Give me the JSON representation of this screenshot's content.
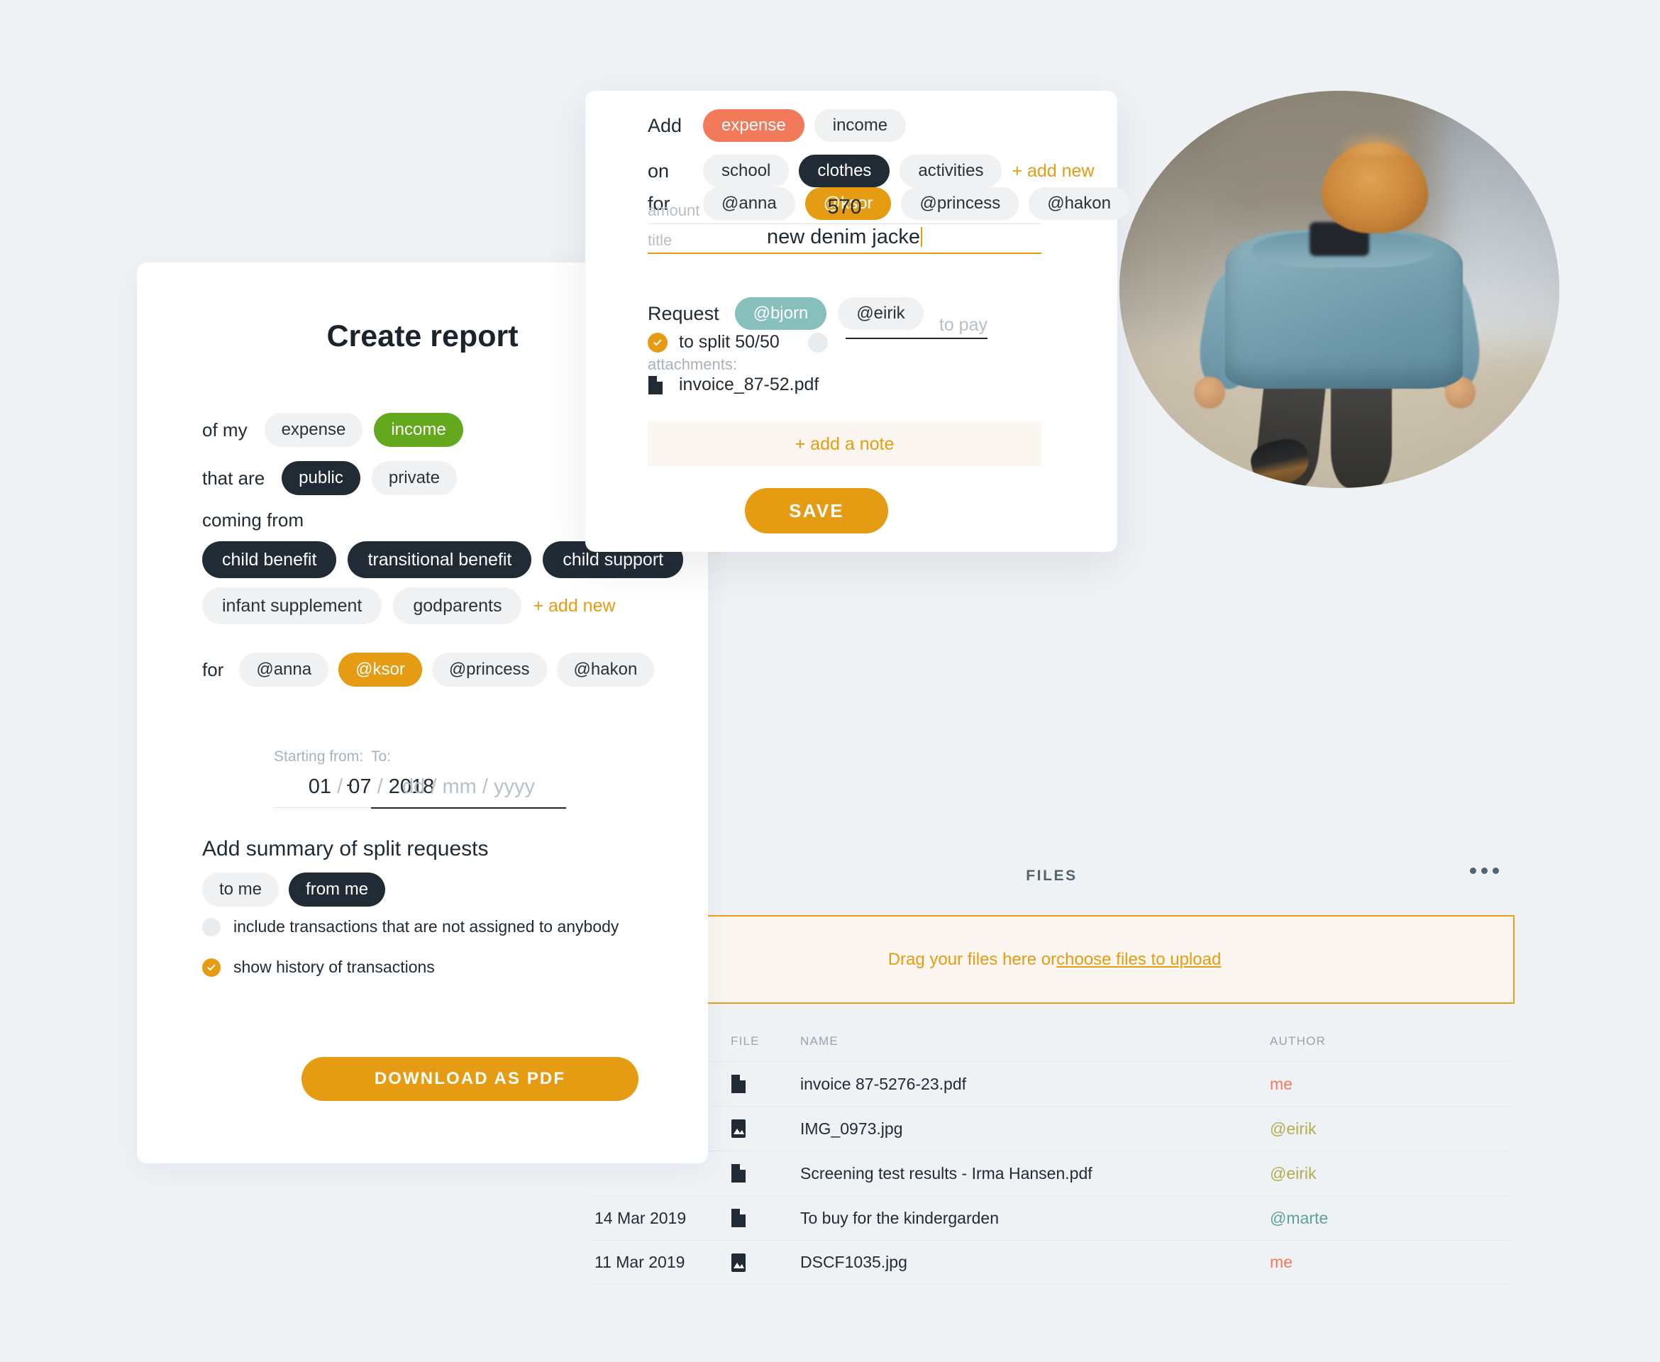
{
  "report_card": {
    "title": "Create report",
    "type_row": {
      "label": "of my",
      "options": [
        {
          "label": "expense",
          "selected": false,
          "style": "plain"
        },
        {
          "label": "income",
          "selected": true,
          "style": "green"
        }
      ]
    },
    "visibility_row": {
      "label": "that are",
      "options": [
        {
          "label": "public",
          "selected": true,
          "style": "dark"
        },
        {
          "label": "private",
          "selected": false,
          "style": "plain"
        }
      ]
    },
    "source_row": {
      "label": "coming from",
      "options": [
        {
          "label": "child benefit",
          "selected": true,
          "style": "dark"
        },
        {
          "label": "transitional benefit",
          "selected": true,
          "style": "dark"
        },
        {
          "label": "child support",
          "selected": true,
          "style": "dark"
        },
        {
          "label": "infant supplement",
          "selected": false,
          "style": "plain"
        },
        {
          "label": "godparents",
          "selected": false,
          "style": "plain"
        }
      ],
      "add_new": "+ add new"
    },
    "for_row": {
      "label": "for",
      "options": [
        {
          "label": "@anna",
          "selected": false,
          "style": "plain"
        },
        {
          "label": "@ksor",
          "selected": true,
          "style": "amber"
        },
        {
          "label": "@princess",
          "selected": false,
          "style": "plain"
        },
        {
          "label": "@hakon",
          "selected": false,
          "style": "plain"
        }
      ]
    },
    "date_from": {
      "label": "Starting from:",
      "day": "01",
      "month": "07",
      "year": "2018",
      "sep": "/"
    },
    "date_to": {
      "label": "To:",
      "placeholder": "dd / mm / yyyy"
    },
    "dash": "-",
    "summary_label": "Add summary of split requests",
    "summary_options": [
      {
        "label": "to me",
        "selected": false,
        "style": "plain"
      },
      {
        "label": "from me",
        "selected": true,
        "style": "dark"
      }
    ],
    "checkboxes": [
      {
        "label": "include transactions that are not assigned to anybody",
        "checked": false
      },
      {
        "label": "show history of transactions",
        "checked": true
      }
    ],
    "download_label": "DOWNLOAD AS PDF"
  },
  "add_card": {
    "add_row": {
      "label": "Add",
      "options": [
        {
          "label": "expense",
          "selected": true,
          "style": "coral"
        },
        {
          "label": "income",
          "selected": false,
          "style": "plain"
        }
      ]
    },
    "on_row": {
      "label": "on",
      "options": [
        {
          "label": "school",
          "selected": false,
          "style": "plain"
        },
        {
          "label": "clothes",
          "selected": true,
          "style": "dark"
        },
        {
          "label": "activities",
          "selected": false,
          "style": "plain"
        }
      ],
      "add_new": "+ add new"
    },
    "for_row": {
      "label": "for",
      "options": [
        {
          "label": "@anna",
          "selected": false,
          "style": "plain"
        },
        {
          "label": "@ksor",
          "selected": true,
          "style": "amber"
        },
        {
          "label": "@princess",
          "selected": false,
          "style": "plain"
        },
        {
          "label": "@hakon",
          "selected": false,
          "style": "plain"
        }
      ]
    },
    "amount_field": {
      "label": "amount",
      "value": "570"
    },
    "title_field": {
      "label": "title",
      "value": "new denim jacke"
    },
    "request_row": {
      "label": "Request",
      "options": [
        {
          "label": "@bjorn",
          "selected": true,
          "style": "teal"
        },
        {
          "label": "@eirik",
          "selected": false,
          "style": "plain"
        }
      ]
    },
    "split_option": {
      "label": "to split 50/50",
      "checked": true
    },
    "pay_option": {
      "checked": false,
      "placeholder": "to pay"
    },
    "attachments_label": "attachments:",
    "attachments": [
      {
        "name": "invoice_87-52.pdf",
        "icon": "document-icon"
      }
    ],
    "add_note_label": "+ add a note",
    "save_label": "SAVE"
  },
  "files_panel": {
    "title": "FILES",
    "more_label": "...",
    "dropzone": {
      "text": "Drag your files here or ",
      "link": "choose files to upload"
    },
    "columns": [
      "",
      "FILE",
      "NAME",
      "AUTHOR"
    ],
    "rows": [
      {
        "date": "",
        "icon": "document-icon",
        "name": "invoice 87-5276-23.pdf",
        "author": "me",
        "author_style": "me"
      },
      {
        "date": "",
        "icon": "image-icon",
        "name": "IMG_0973.jpg",
        "author": "@eirik",
        "author_style": "eirik"
      },
      {
        "date": "",
        "icon": "document-icon",
        "name": "Screening test results - Irma Hansen.pdf",
        "author": "@eirik",
        "author_style": "eirik"
      },
      {
        "date": "14 Mar 2019",
        "icon": "document-icon",
        "name": "To buy for the kindergarden",
        "author": "@marte",
        "author_style": "marte"
      },
      {
        "date": "11 Mar 2019",
        "icon": "image-icon",
        "name": "DSCF1035.jpg",
        "author": "me",
        "author_style": "me"
      }
    ]
  },
  "colors": {
    "background": "#eff2f5",
    "card": "#ffffff",
    "amber": "#e59b12",
    "coral": "#f2795a",
    "green": "#64a81e",
    "dark": "#212b36",
    "teal": "#86bfbb",
    "chip_plain": "#f0f1f3",
    "author_me": "#f2795a",
    "author_eirik": "#b3ad4e",
    "author_marte": "#5f9f9c"
  },
  "photo": {
    "alt": "child-in-denim-jacket-photo"
  }
}
